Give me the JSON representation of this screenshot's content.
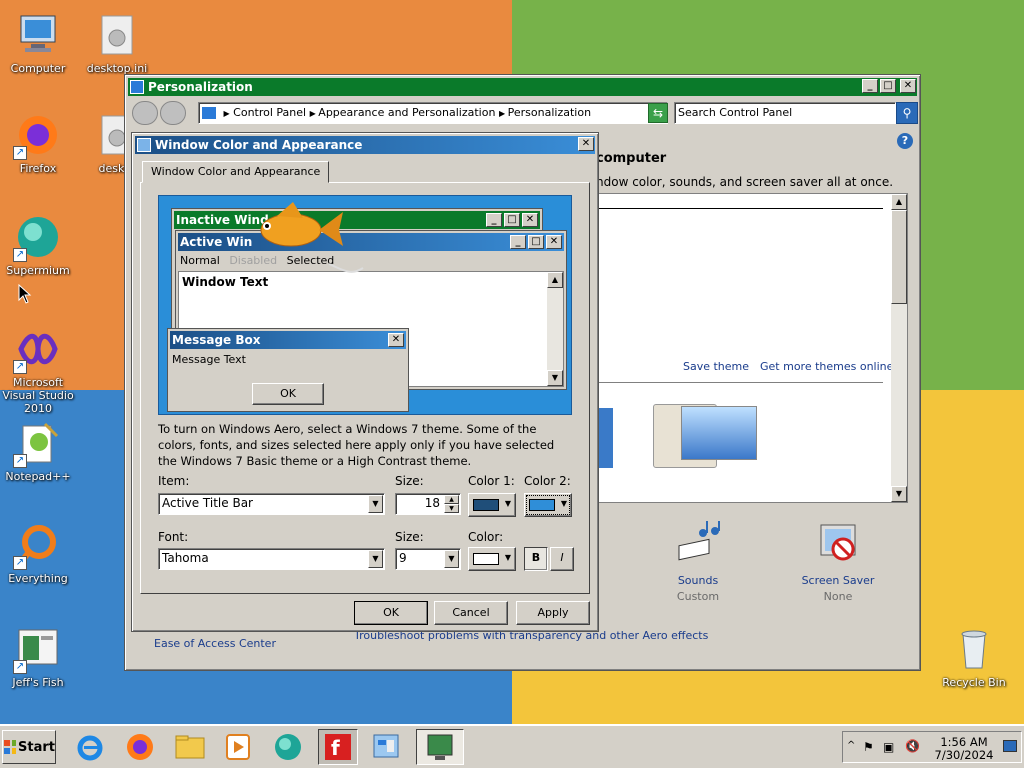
{
  "desktop": {
    "icons": [
      {
        "label": "Computer",
        "icon": "computer-icon"
      },
      {
        "label": "desktop.ini",
        "icon": "settings-file-icon"
      },
      {
        "label": "Firefox",
        "icon": "firefox-icon"
      },
      {
        "label": "deskto",
        "icon": "settings-file-icon"
      },
      {
        "label": "Supermium",
        "icon": "supermium-icon"
      },
      {
        "label": "Microsoft Visual Studio 2010",
        "icon": "visual-studio-icon"
      },
      {
        "label": "Notepad++",
        "icon": "notepad-plus-plus-icon"
      },
      {
        "label": "Everything",
        "icon": "everything-search-icon"
      },
      {
        "label": "Jeff's Fish",
        "icon": "jeffs-fish-icon"
      },
      {
        "label": "Recycle Bin",
        "icon": "recycle-bin-icon"
      }
    ]
  },
  "personalization": {
    "title": "Personalization",
    "breadcrumb": [
      "Control Panel",
      "Appearance and Personalization",
      "Personalization"
    ],
    "search_placeholder": "Search Control Panel",
    "heading_partial": "computer",
    "desc_partial": "ndow color, sounds, and screen saver all at once.",
    "save_theme": "Save theme",
    "get_more_themes": "Get more themes online",
    "sounds_label": "Sounds",
    "sounds_value": "Custom",
    "screensaver_label": "Screen Saver",
    "screensaver_value": "None",
    "ease_of_access": "Ease of Access Center",
    "troubleshoot": "Troubleshoot problems with transparency and other Aero effects"
  },
  "dialog": {
    "title": "Window Color and Appearance",
    "tab": "Window Color and Appearance",
    "preview": {
      "inactive_title": "Inactive Wind",
      "active_title": "Active Win",
      "menu_normal": "Normal",
      "menu_disabled": "Disabled",
      "menu_selected": "Selected",
      "window_text": "Window Text",
      "msgbox_title": "Message Box",
      "msgbox_text": "Message Text",
      "msgbox_ok": "OK"
    },
    "info": "To turn on Windows Aero, select a Windows 7 theme.  Some of the colors, fonts, and sizes selected here apply only if you have selected the Windows 7 Basic theme or a High Contrast theme.",
    "item_label": "Item:",
    "item_value": "Active Title Bar",
    "size_label": "Size:",
    "size_value": "18",
    "color1_label": "Color 1:",
    "color2_label": "Color 2:",
    "font_label": "Font:",
    "font_value": "Tahoma",
    "font_size_label": "Size:",
    "font_size_value": "9",
    "font_color_label": "Color:",
    "bold": "B",
    "italic": "I",
    "ok": "OK",
    "cancel": "Cancel",
    "apply": "Apply",
    "colors": {
      "color1": "#1f4e79",
      "color2": "#2f8ed8",
      "font_color": "#ffffff"
    }
  },
  "taskbar": {
    "start": "Start",
    "time": "1:56 AM",
    "date": "7/30/2024"
  }
}
